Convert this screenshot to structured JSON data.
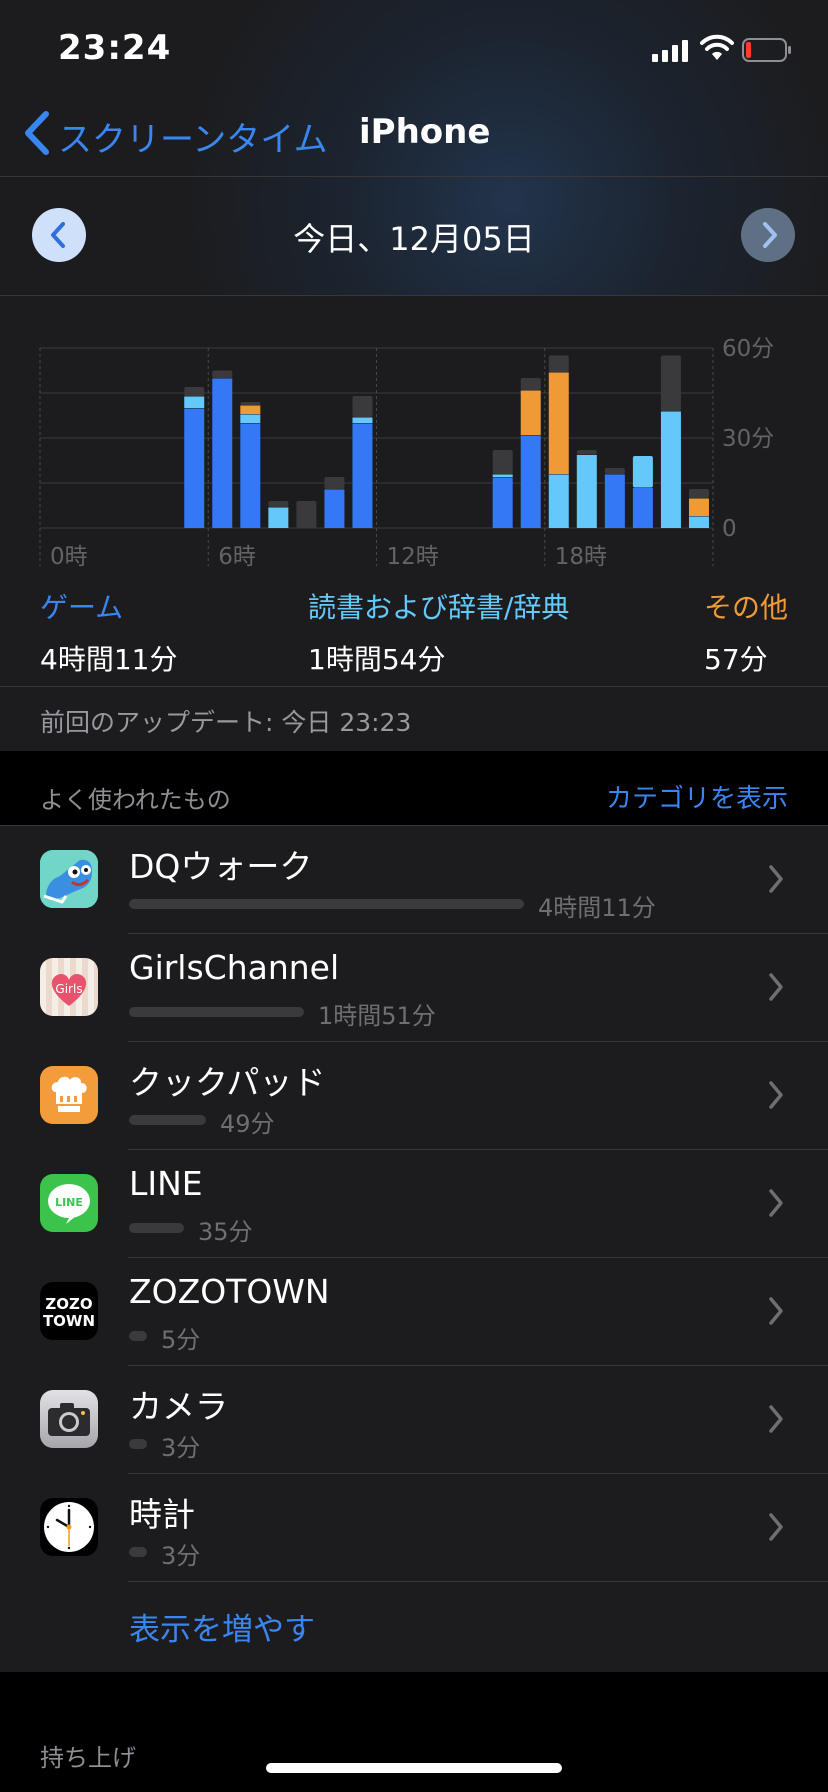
{
  "status": {
    "time": "23:24"
  },
  "nav": {
    "back_label": "スクリーンタイム",
    "title": "iPhone"
  },
  "date": {
    "label": "今日、12月05日"
  },
  "chart_data": {
    "type": "bar",
    "stacked": true,
    "x_tick_labels": [
      "0時",
      "6時",
      "12時",
      "18時"
    ],
    "y_tick_labels": [
      "60分",
      "30分",
      "0"
    ],
    "ylim": [
      0,
      60
    ],
    "grid": true,
    "series": [
      {
        "name": "ゲーム",
        "color": "#3478f6"
      },
      {
        "name": "読書および辞書/辞典",
        "color": "#64c8fa"
      },
      {
        "name": "その他",
        "color": "#f09a37"
      },
      {
        "name": "",
        "color": "#3a3a3c"
      }
    ],
    "hours": [
      {
        "h": 0,
        "v": [
          0,
          0,
          0,
          0
        ]
      },
      {
        "h": 1,
        "v": [
          0,
          0,
          0,
          0
        ]
      },
      {
        "h": 2,
        "v": [
          0,
          0,
          0,
          0
        ]
      },
      {
        "h": 3,
        "v": [
          0,
          0,
          0,
          0
        ]
      },
      {
        "h": 4,
        "v": [
          0,
          0,
          0,
          0
        ]
      },
      {
        "h": 5,
        "v": [
          40,
          4,
          0,
          3
        ]
      },
      {
        "h": 6,
        "v": [
          50,
          0,
          0,
          2.5
        ]
      },
      {
        "h": 7,
        "v": [
          35,
          3,
          3,
          1
        ]
      },
      {
        "h": 8,
        "v": [
          0,
          7,
          0,
          2
        ]
      },
      {
        "h": 9,
        "v": [
          0,
          0,
          0,
          9
        ]
      },
      {
        "h": 10,
        "v": [
          13,
          0,
          0,
          4
        ]
      },
      {
        "h": 11,
        "v": [
          35,
          2,
          0,
          7
        ]
      },
      {
        "h": 12,
        "v": [
          0,
          0,
          0,
          0
        ]
      },
      {
        "h": 13,
        "v": [
          0,
          0,
          0,
          0
        ]
      },
      {
        "h": 14,
        "v": [
          0,
          0,
          0,
          0
        ]
      },
      {
        "h": 15,
        "v": [
          0,
          0,
          0,
          0
        ]
      },
      {
        "h": 16,
        "v": [
          17,
          1,
          0,
          8
        ]
      },
      {
        "h": 17,
        "v": [
          31,
          0,
          15,
          4
        ]
      },
      {
        "h": 18,
        "v": [
          0,
          18,
          34,
          5.5
        ]
      },
      {
        "h": 19,
        "v": [
          0,
          24.5,
          0,
          1.5
        ]
      },
      {
        "h": 20,
        "v": [
          18,
          0,
          0,
          2
        ]
      },
      {
        "h": 21,
        "v": [
          13.5,
          10.5,
          0,
          0
        ]
      },
      {
        "h": 22,
        "v": [
          0,
          39,
          0,
          18.5
        ]
      },
      {
        "h": 23,
        "v": [
          0,
          4,
          6,
          3
        ]
      }
    ]
  },
  "categories": [
    {
      "label": "ゲーム",
      "value": "4時間11分",
      "color": "#3a86f0"
    },
    {
      "label": "読書および辞書/辞典",
      "value": "1時間54分",
      "color": "#64c8fa"
    },
    {
      "label": "その他",
      "value": "57分",
      "color": "#f09a37"
    }
  ],
  "update": {
    "text": "前回のアップデート: 今日 23:23"
  },
  "most_used": {
    "title": "よく使われたもの",
    "link": "カテゴリを表示"
  },
  "apps": [
    {
      "name": "DQウォーク",
      "time": "4時間11分",
      "fraction": 1.0,
      "icon": "dq-walk-icon"
    },
    {
      "name": "GirlsChannel",
      "time": "1時間51分",
      "fraction": 0.442,
      "icon": "girls-channel-icon"
    },
    {
      "name": "クックパッド",
      "time": "49分",
      "fraction": 0.195,
      "icon": "cookpad-icon"
    },
    {
      "name": "LINE",
      "time": "35分",
      "fraction": 0.139,
      "icon": "line-icon"
    },
    {
      "name": "ZOZOTOWN",
      "time": "5分",
      "fraction": 0.02,
      "icon": "zozotown-icon"
    },
    {
      "name": "カメラ",
      "time": "3分",
      "fraction": 0.012,
      "icon": "camera-icon"
    },
    {
      "name": "時計",
      "time": "3分",
      "fraction": 0.012,
      "icon": "clock-icon"
    }
  ],
  "icon_text": {
    "line": "LINE",
    "zozo_top": "ZOZO",
    "zozo_bottom": "TOWN",
    "girls": "Girls"
  },
  "show_more": "表示を増やす",
  "pickups": {
    "title": "持ち上げ"
  }
}
